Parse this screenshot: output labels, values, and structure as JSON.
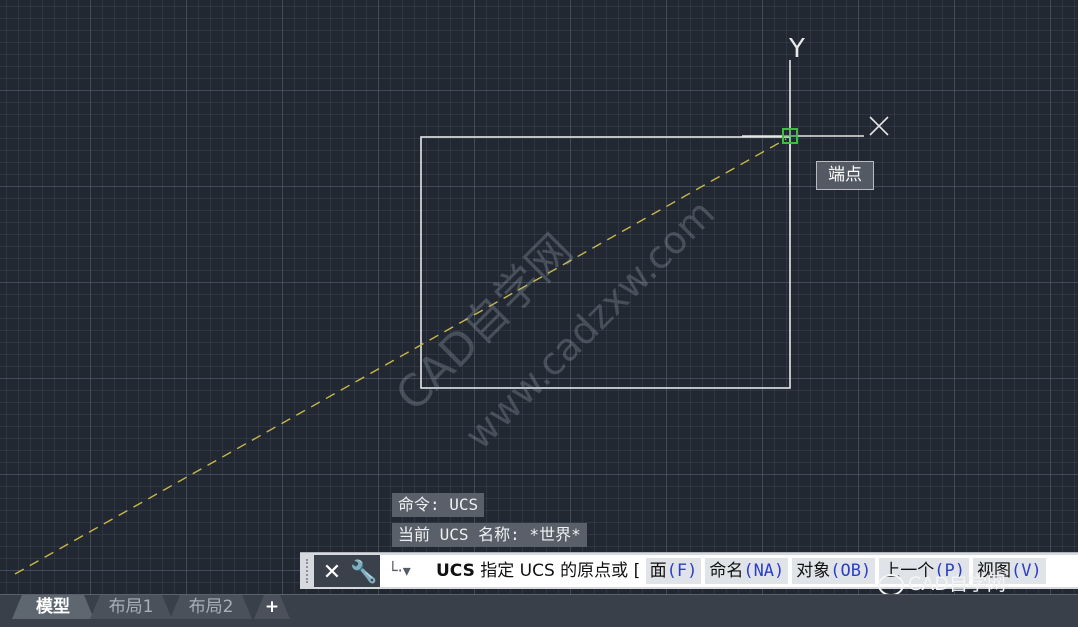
{
  "viewport": {
    "axis_y_label": "Y",
    "axis_x_label": "X",
    "osnap_tooltip": "端点",
    "watermark_line1": "CAD自学网",
    "watermark_line2": "www.cadzxw.com"
  },
  "history": [
    "命令: UCS",
    "当前 UCS 名称: *世界*"
  ],
  "command_line": {
    "close_icon": "close-icon",
    "customize_icon": "wrench-icon",
    "prompt_command": "UCS",
    "prompt_text": "指定 UCS 的原点或 [",
    "options": [
      {
        "label": "面",
        "key": "F"
      },
      {
        "label": "命名",
        "key": "NA"
      },
      {
        "label": "对象",
        "key": "OB"
      },
      {
        "label": "上一个",
        "key": "P"
      },
      {
        "label": "视图",
        "key": "V"
      }
    ]
  },
  "layout_tabs": [
    {
      "label": "模型",
      "active": true
    },
    {
      "label": "布局1",
      "active": false
    },
    {
      "label": "布局2",
      "active": false
    }
  ],
  "add_tab_label": "+",
  "logo_text": "CAD自学网",
  "colors": {
    "background": "#212832",
    "geometry": "#e6e6e6",
    "tracking_line": "#c9b74a",
    "osnap_marker": "#3cc03c"
  }
}
